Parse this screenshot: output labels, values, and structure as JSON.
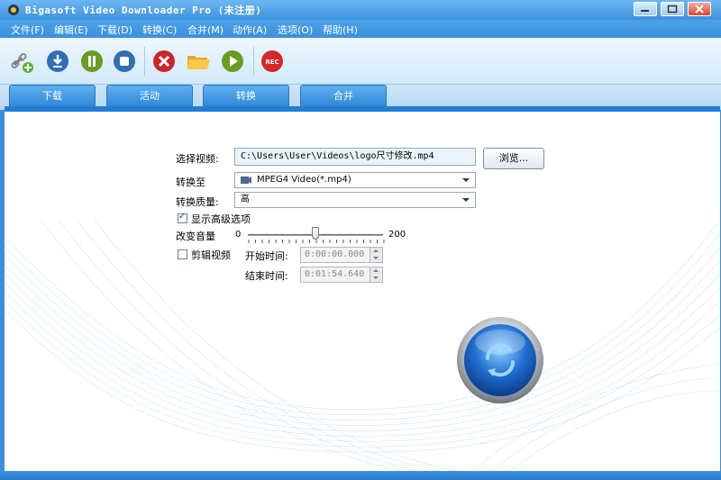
{
  "window": {
    "title": "Bigasoft Video Downloader Pro (未注册)",
    "controls": [
      "minimize",
      "maximize",
      "close"
    ]
  },
  "menu": [
    "文件(F)",
    "编辑(E)",
    "下载(D)",
    "转换(C)",
    "合并(M)",
    "动作(A)",
    "选项(O)",
    "帮助(H)"
  ],
  "toolbar": {
    "buttons": [
      "add-url-icon",
      "download-icon",
      "pause-icon",
      "stop-icon",
      "delete-icon",
      "open-folder-icon",
      "play-icon",
      "record-icon"
    ],
    "record_label": "REC"
  },
  "tabs": [
    {
      "label": "下载",
      "active": false
    },
    {
      "label": "活动",
      "active": false
    },
    {
      "label": "转换",
      "active": true
    },
    {
      "label": "合并",
      "active": false
    }
  ],
  "form": {
    "select_video_label": "选择视频:",
    "video_path": "C:\\Users\\User\\Videos\\logo尺寸修改.mp4",
    "browse_label": "浏览...",
    "convert_to_label": "转换至",
    "convert_to_value": "MPEG4 Video(*.mp4)",
    "quality_label": "转换质量:",
    "quality_value": "高",
    "show_advanced_label": "显示高级选项",
    "show_advanced_checked": true,
    "volume_label": "改变音量",
    "volume_min": "0",
    "volume_max": "200",
    "volume_value": 100,
    "trim_label": "剪辑视频",
    "trim_checked": false,
    "start_time_label": "开始时间:",
    "start_time_value": "0:00:00.000",
    "end_time_label": "结束时间:",
    "end_time_value": "0:01:54.640"
  },
  "colors": {
    "accent": "#2f84d4",
    "titlebar": "#3e92de",
    "convert_button": "#1f6fd0"
  }
}
